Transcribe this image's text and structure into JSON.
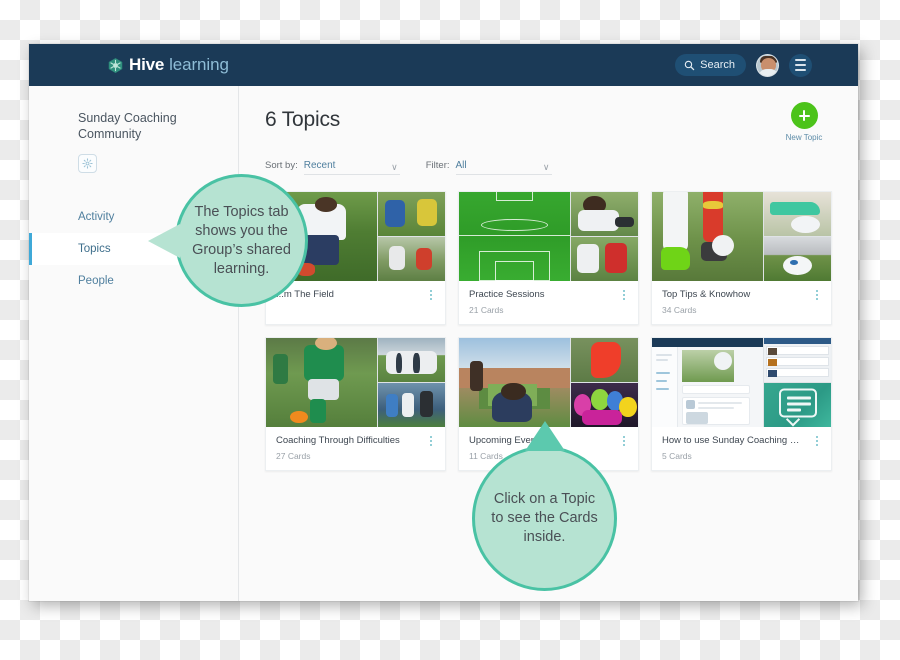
{
  "brand": {
    "logo_icon": "hive-hexagon-logo",
    "name_bold": "Hive",
    "name_light": "learning"
  },
  "topbar": {
    "search_label": "Search",
    "search_icon": "search-icon",
    "avatar_name": "user-avatar",
    "menu_icon": "hamburger-menu-icon"
  },
  "sidebar": {
    "group_name": "Sunday Coaching Community",
    "settings_icon": "gear-icon",
    "items": [
      {
        "label": "Activity",
        "active": false
      },
      {
        "label": "Topics",
        "active": true
      },
      {
        "label": "People",
        "active": false
      }
    ]
  },
  "main": {
    "page_title": "6 Topics",
    "new_topic": {
      "label": "New Topic",
      "plus_icon": "plus-icon",
      "color": "#4cc31a"
    },
    "controls": [
      {
        "label": "Sort by:",
        "value": "Recent",
        "caret_icon": "chevron-down-icon"
      },
      {
        "label": "Filter:",
        "value": "All",
        "caret_icon": "chevron-down-icon"
      }
    ],
    "topics": [
      {
        "title": "...m The Field",
        "cards": "",
        "menu_icon": "kebab-menu-icon"
      },
      {
        "title": "Practice Sessions",
        "cards": "21 Cards",
        "menu_icon": "kebab-menu-icon"
      },
      {
        "title": "Top Tips & Knowhow",
        "cards": "34 Cards",
        "menu_icon": "kebab-menu-icon"
      },
      {
        "title": "Coaching Through Difficulties",
        "cards": "27 Cards",
        "menu_icon": "kebab-menu-icon"
      },
      {
        "title": "Upcoming Events",
        "cards": "11 Cards",
        "menu_icon": "kebab-menu-icon"
      },
      {
        "title": "How to use Sunday Coaching Com...",
        "cards": "5 Cards",
        "menu_icon": "kebab-menu-icon"
      }
    ]
  },
  "callouts": [
    {
      "text": "The Topics tab shows you the Group’s shared learning.",
      "fill": "#b6e3d2",
      "stroke": "#49c2a4"
    },
    {
      "text": "Click on a Topic to see the Cards inside.",
      "fill": "#b6e3d2",
      "stroke": "#49c2a4"
    }
  ]
}
